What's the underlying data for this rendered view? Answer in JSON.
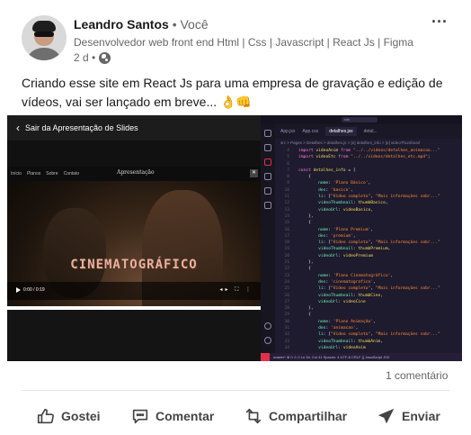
{
  "author": {
    "name": "Leandro Santos",
    "separator": "•",
    "relation": "Você",
    "headline": "Desenvolvedor web front end Html | Css | Javascript | React Js | Figma",
    "time": "2 d •"
  },
  "post": {
    "text": "Criando esse site em React Js para uma empresa de gravação e edição de vídeos, vai ser lançado em breve... 👌👊"
  },
  "media": {
    "viewer_back_label": "Sair da Apresentação de Slides",
    "site_nav": [
      "Início",
      "Planos",
      "Sobre",
      "Contato"
    ],
    "site_brand": "Apresentação",
    "hero_title": "CINEMATOGRÁFICO",
    "video_time": "0:00 / 0:19",
    "editor_search": "site",
    "editor_tabs": [
      "App.jsx",
      "App.css",
      "detalhes.jsx",
      "detal..."
    ],
    "editor_breadcrumb": "src > Pages > Detalhes > detalhes.js > [e] detalhes_info > [e] videoThumbnail",
    "editor_status": "master*  ⊗ 0 ⚠ 0   Ln 34, Col 41   Spaces: 4   UTF-8   CRLF   {} JavaScript JSX"
  },
  "code_lines": [
    {
      "n": "4",
      "t": [
        [
          "kw",
          "import "
        ],
        [
          "id",
          "videoAnim "
        ],
        [
          "kw",
          "from "
        ],
        [
          "str",
          "\"../../videos/detalhes_animacao...\""
        ]
      ]
    },
    {
      "n": "5",
      "t": [
        [
          "kw",
          "import "
        ],
        [
          "id",
          "videoEtc "
        ],
        [
          "kw",
          "from "
        ],
        [
          "str",
          "\"../../videos/detalhes_etc.mp4\""
        ],
        [
          "pl",
          ";"
        ]
      ]
    },
    {
      "n": "6",
      "t": []
    },
    {
      "n": "7",
      "t": [
        [
          "kw",
          "const "
        ],
        [
          "id",
          "detalhes_info "
        ],
        [
          "pl",
          "= ["
        ]
      ]
    },
    {
      "n": "8",
      "t": [
        [
          "pl",
          "    {"
        ]
      ]
    },
    {
      "n": "9",
      "t": [
        [
          "prop",
          "        nome"
        ],
        [
          "pl",
          ": "
        ],
        [
          "str",
          "'Plano Básico'"
        ],
        [
          "pl",
          ","
        ]
      ]
    },
    {
      "n": "10",
      "t": [
        [
          "prop",
          "        des"
        ],
        [
          "pl",
          ": "
        ],
        [
          "str",
          "'basico'"
        ],
        [
          "pl",
          ","
        ]
      ]
    },
    {
      "n": "11",
      "t": [
        [
          "prop",
          "        li"
        ],
        [
          "pl",
          ": ["
        ],
        [
          "str",
          "\"Vídeo completo\""
        ],
        [
          "pl",
          ", "
        ],
        [
          "str",
          "\"Mais informações sobr...\""
        ]
      ]
    },
    {
      "n": "12",
      "t": [
        [
          "prop",
          "        videoThumbnail"
        ],
        [
          "pl",
          ": "
        ],
        [
          "id",
          "thumbBasico"
        ],
        [
          "pl",
          ","
        ]
      ]
    },
    {
      "n": "13",
      "t": [
        [
          "prop",
          "        videoUrl"
        ],
        [
          "pl",
          ": "
        ],
        [
          "id",
          "videoBasico"
        ],
        [
          "pl",
          ","
        ]
      ]
    },
    {
      "n": "14",
      "t": [
        [
          "pl",
          "    },"
        ]
      ]
    },
    {
      "n": "15",
      "t": [
        [
          "pl",
          "    {"
        ]
      ]
    },
    {
      "n": "16",
      "t": [
        [
          "prop",
          "        nome"
        ],
        [
          "pl",
          ": "
        ],
        [
          "str",
          "'Plano Premium'"
        ],
        [
          "pl",
          ","
        ]
      ]
    },
    {
      "n": "17",
      "t": [
        [
          "prop",
          "        des"
        ],
        [
          "pl",
          ": "
        ],
        [
          "str",
          "'premium'"
        ],
        [
          "pl",
          ","
        ]
      ]
    },
    {
      "n": "18",
      "t": [
        [
          "prop",
          "        li"
        ],
        [
          "pl",
          ": ["
        ],
        [
          "str",
          "\"Vídeo completo\""
        ],
        [
          "pl",
          ", "
        ],
        [
          "str",
          "\"Mais informações sobr...\""
        ]
      ]
    },
    {
      "n": "19",
      "t": [
        [
          "prop",
          "        videoThumbnail"
        ],
        [
          "pl",
          ": "
        ],
        [
          "id",
          "thumbPremium"
        ],
        [
          "pl",
          ","
        ]
      ]
    },
    {
      "n": "20",
      "t": [
        [
          "prop",
          "        videoUrl"
        ],
        [
          "pl",
          ": "
        ],
        [
          "id",
          "videoPremium"
        ]
      ]
    },
    {
      "n": "21",
      "t": [
        [
          "pl",
          "    },"
        ]
      ]
    },
    {
      "n": "22",
      "t": [
        [
          "pl",
          "    {"
        ]
      ]
    },
    {
      "n": "23",
      "t": [
        [
          "prop",
          "        nome"
        ],
        [
          "pl",
          ": "
        ],
        [
          "str",
          "'Plano Cinematográfico'"
        ],
        [
          "pl",
          ","
        ]
      ]
    },
    {
      "n": "24",
      "t": [
        [
          "prop",
          "        des"
        ],
        [
          "pl",
          ": "
        ],
        [
          "str",
          "'cinematografico'"
        ],
        [
          "pl",
          ","
        ]
      ]
    },
    {
      "n": "25",
      "t": [
        [
          "prop",
          "        li"
        ],
        [
          "pl",
          ": ["
        ],
        [
          "str",
          "\"Vídeo completo\""
        ],
        [
          "pl",
          ", "
        ],
        [
          "str",
          "\"Mais informações sobr...\""
        ]
      ]
    },
    {
      "n": "26",
      "t": [
        [
          "prop",
          "        videoThumbnail"
        ],
        [
          "pl",
          ": "
        ],
        [
          "id",
          "thumbCine"
        ],
        [
          "pl",
          ","
        ]
      ]
    },
    {
      "n": "27",
      "t": [
        [
          "prop",
          "        videoUrl"
        ],
        [
          "pl",
          ": "
        ],
        [
          "id",
          "videoCine"
        ]
      ]
    },
    {
      "n": "28",
      "t": [
        [
          "pl",
          "    },"
        ]
      ]
    },
    {
      "n": "29",
      "t": [
        [
          "pl",
          "    {"
        ]
      ]
    },
    {
      "n": "30",
      "t": [
        [
          "prop",
          "        nome"
        ],
        [
          "pl",
          ": "
        ],
        [
          "str",
          "'Plano Animação'"
        ],
        [
          "pl",
          ","
        ]
      ]
    },
    {
      "n": "31",
      "t": [
        [
          "prop",
          "        des"
        ],
        [
          "pl",
          ": "
        ],
        [
          "str",
          "'animacao'"
        ],
        [
          "pl",
          ","
        ]
      ]
    },
    {
      "n": "32",
      "t": [
        [
          "prop",
          "        li"
        ],
        [
          "pl",
          ": ["
        ],
        [
          "str",
          "\"Vídeo completo\""
        ],
        [
          "pl",
          ", "
        ],
        [
          "str",
          "\"Mais informações sobr...\""
        ]
      ]
    },
    {
      "n": "33",
      "t": [
        [
          "prop",
          "        videoThumbnail"
        ],
        [
          "pl",
          ": "
        ],
        [
          "id",
          "thumbAnim"
        ],
        [
          "pl",
          ","
        ]
      ]
    },
    {
      "n": "34",
      "t": [
        [
          "prop",
          "        videoUrl"
        ],
        [
          "pl",
          ": "
        ],
        [
          "id",
          "videoAnim"
        ]
      ]
    }
  ],
  "social": {
    "comments": "1 comentário"
  },
  "actions": {
    "like": "Gostei",
    "comment": "Comentar",
    "share": "Compartilhar",
    "send": "Enviar"
  },
  "icons": {
    "more": "more-horizontal-icon",
    "visibility": "globe-icon",
    "like": "thumbs-up-icon",
    "comment": "comment-icon",
    "share": "repost-icon",
    "send": "send-icon"
  }
}
